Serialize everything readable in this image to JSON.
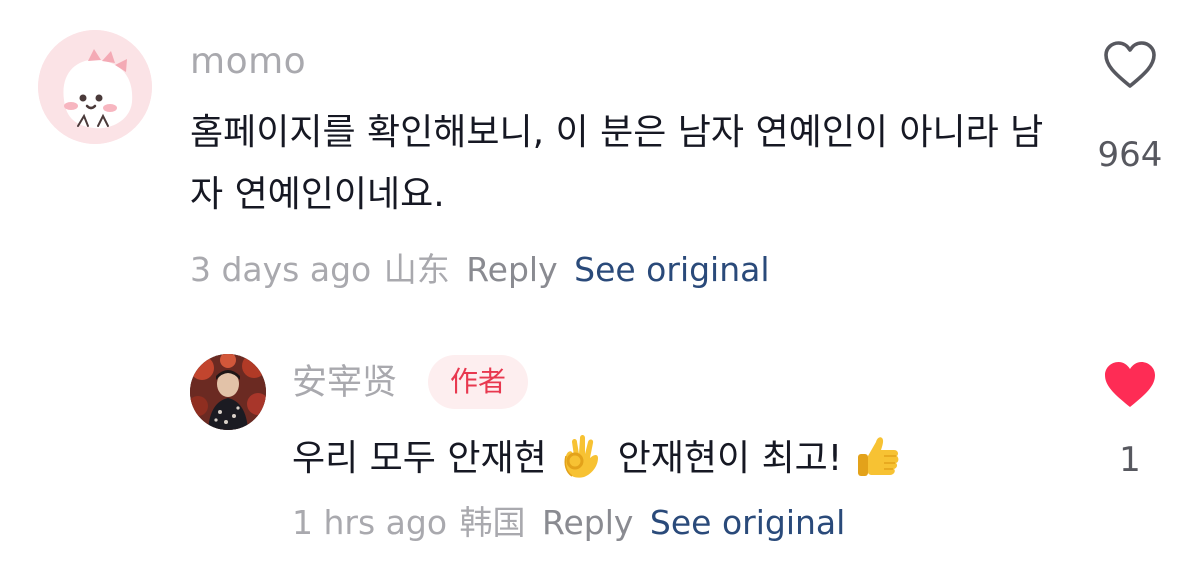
{
  "comments": [
    {
      "author": "momo",
      "text": "홈페이지를 확인해보니, 이 분은 남자 연예인이 아니라 남자 연예인이네요.",
      "time": "3 days ago",
      "region": "山东",
      "reply_label": "Reply",
      "see_original_label": "See original",
      "like_count": "964",
      "liked": false
    }
  ],
  "reply": {
    "author": "安宰贤",
    "badge": "作者",
    "text_part1": "우리 모두 안재현",
    "text_part2": "안재현이 최고!",
    "emoji1": "ok-hand-emoji",
    "emoji2": "thumbs-up-emoji",
    "time": "1 hrs ago",
    "region": "韩国",
    "reply_label": "Reply",
    "see_original_label": "See original",
    "like_count": "1",
    "liked": true
  },
  "colors": {
    "secondary_text": "#a9a9ae",
    "link": "#2a4a7a",
    "like_active": "#fe2c55",
    "badge_bg": "#fdeeef",
    "badge_text": "#e8384f"
  }
}
